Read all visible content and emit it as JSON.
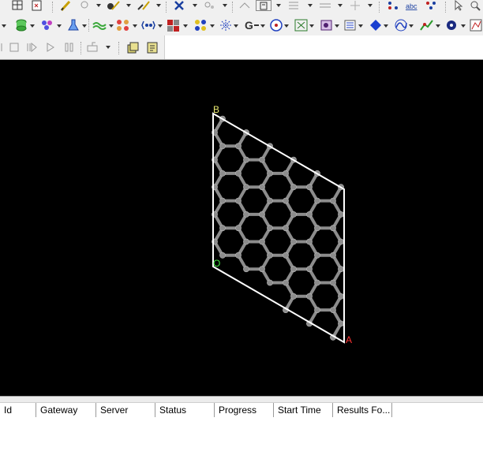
{
  "toolbar_top": {
    "icons": [
      "layout-icon",
      "document-export-icon",
      "pencil-icon",
      "circle-tool-icon",
      "atom-pencil-icon",
      "bond-pencil-icon",
      "select-cross-icon",
      "ring-icon",
      "clean-icon",
      "text-box-icon",
      "align-icon",
      "grid-icon",
      "move-icon",
      "symmetry-icon",
      "abc-label-icon",
      "color-atoms-icon",
      "pointer-icon",
      "search-icon"
    ]
  },
  "toolbar_build": {
    "icons": [
      "periodic-icon",
      "cylinder-icon",
      "molecule-icon",
      "flask-icon",
      "wave-icon",
      "crystal-icon",
      "link-icon",
      "supercell-icon",
      "cluster-icon",
      "sparkle-icon",
      "graph-icon",
      "compass-icon",
      "surface-icon",
      "cage-icon",
      "layer-icon",
      "diamond-icon",
      "curve-icon",
      "chart-icon",
      "sphere-icon",
      "analysis-icon"
    ]
  },
  "toolbar_playback": {
    "icons": [
      "first-frame-icon",
      "stop-icon",
      "last-frame-icon",
      "play-icon",
      "pause-icon",
      "export-frame-icon",
      "stack-icon",
      "script-icon"
    ]
  },
  "viewport": {
    "lattice_labels": {
      "a": "A",
      "b": "B",
      "origin": "O"
    },
    "colors": {
      "background": "#000000",
      "cell": "#ffffff",
      "atom": "#8c8c8c",
      "label_a": "#ff3333",
      "label_b": "#e8e870",
      "label_o": "#44ee44"
    }
  },
  "jobs_table": {
    "columns": [
      "Id",
      "Gateway",
      "Server",
      "Status",
      "Progress",
      "Start Time",
      "Results Fo..."
    ],
    "rows": []
  }
}
